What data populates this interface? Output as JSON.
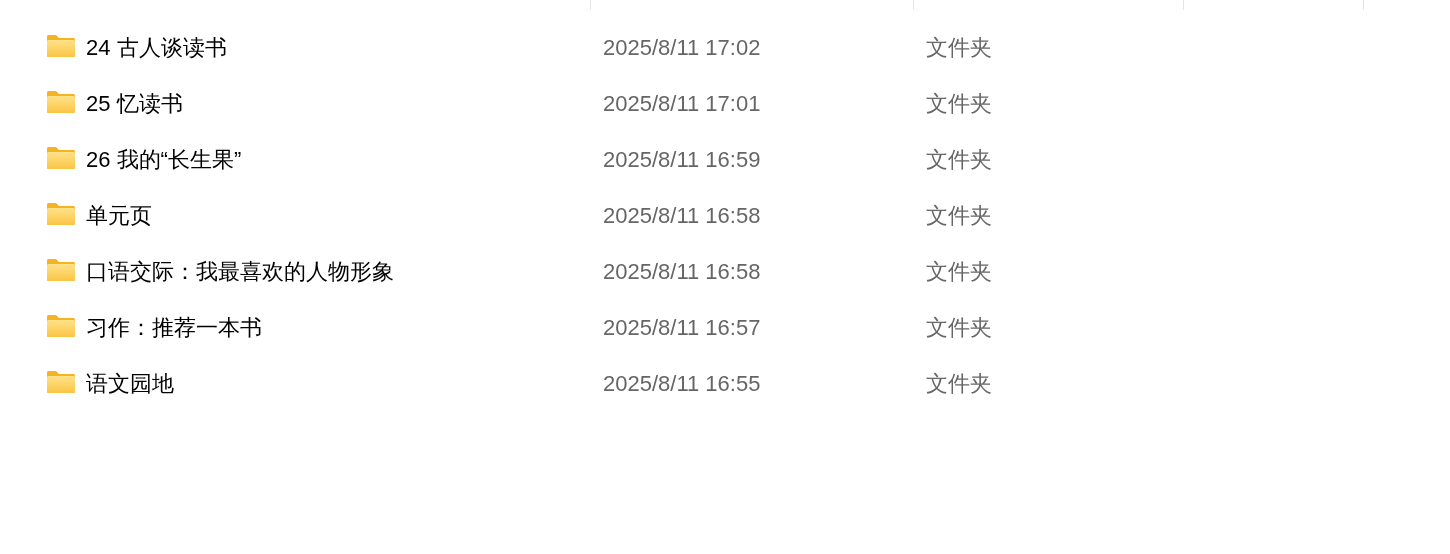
{
  "rows": [
    {
      "name": "24 古人谈读书",
      "modified": "2025/8/11 17:02",
      "type": "文件夹"
    },
    {
      "name": "25 忆读书",
      "modified": "2025/8/11 17:01",
      "type": "文件夹"
    },
    {
      "name": "26 我的“长生果”",
      "modified": "2025/8/11 16:59",
      "type": "文件夹"
    },
    {
      "name": "单元页",
      "modified": "2025/8/11 16:58",
      "type": "文件夹"
    },
    {
      "name": "口语交际：我最喜欢的人物形象",
      "modified": "2025/8/11 16:58",
      "type": "文件夹"
    },
    {
      "name": "习作：推荐一本书",
      "modified": "2025/8/11 16:57",
      "type": "文件夹"
    },
    {
      "name": "语文园地",
      "modified": "2025/8/11 16:55",
      "type": "文件夹"
    }
  ]
}
